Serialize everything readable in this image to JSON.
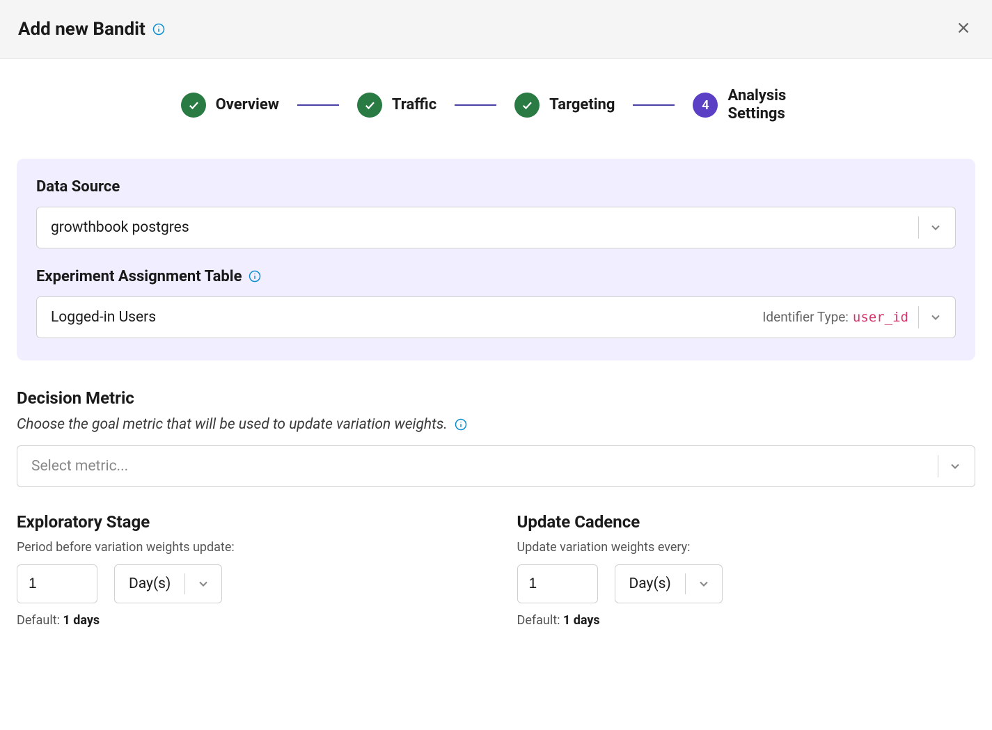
{
  "header": {
    "title": "Add new Bandit"
  },
  "stepper": {
    "steps": [
      {
        "label": "Overview",
        "state": "done"
      },
      {
        "label": "Traffic",
        "state": "done"
      },
      {
        "label": "Targeting",
        "state": "done"
      },
      {
        "label": "Analysis Settings",
        "state": "active",
        "number": "4"
      }
    ]
  },
  "data_source": {
    "label": "Data Source",
    "value": "growthbook postgres"
  },
  "assignment_table": {
    "label": "Experiment Assignment Table",
    "value": "Logged-in Users",
    "identifier_label": "Identifier Type:",
    "identifier_value": "user_id"
  },
  "decision_metric": {
    "title": "Decision Metric",
    "description": "Choose the goal metric that will be used to update variation weights.",
    "placeholder": "Select metric..."
  },
  "exploratory": {
    "title": "Exploratory Stage",
    "sub": "Period before variation weights update:",
    "value": "1",
    "unit": "Day(s)",
    "default_prefix": "Default: ",
    "default_value": "1 days"
  },
  "cadence": {
    "title": "Update Cadence",
    "sub": "Update variation weights every:",
    "value": "1",
    "unit": "Day(s)",
    "default_prefix": "Default: ",
    "default_value": "1 days"
  }
}
